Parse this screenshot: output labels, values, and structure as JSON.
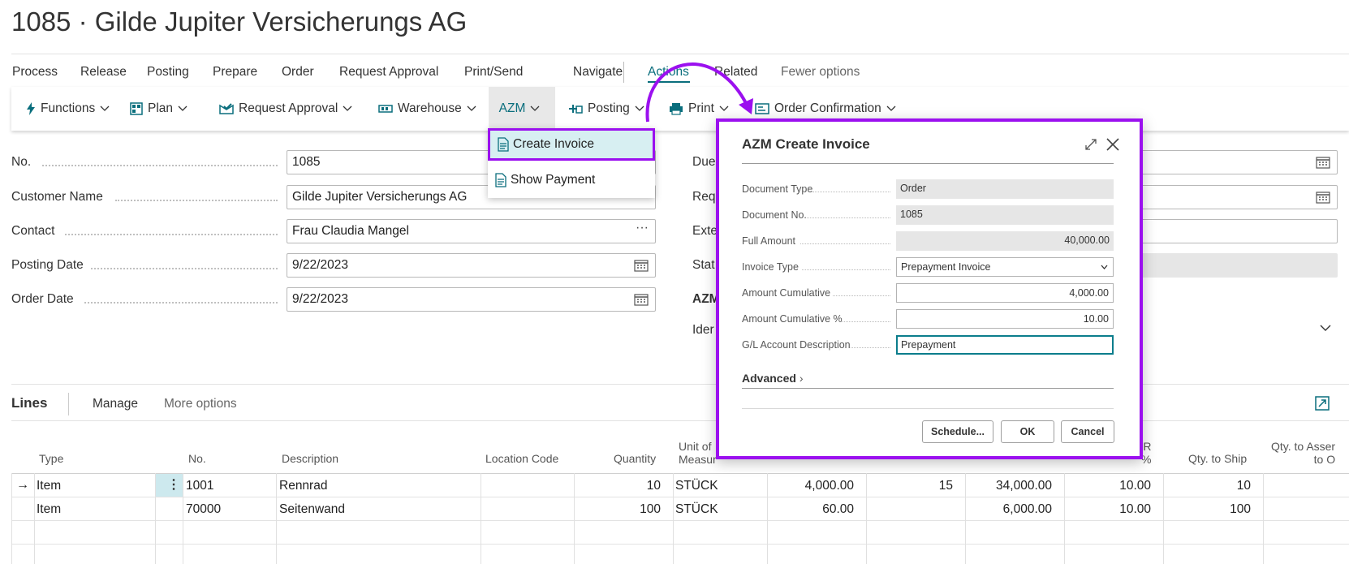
{
  "page_title": "1085 · Gilde Jupiter Versicherungs AG",
  "nav": {
    "items": [
      "Process",
      "Release",
      "Posting",
      "Prepare",
      "Order",
      "Request Approval",
      "Print/Send",
      "Navigate",
      "Actions",
      "Related",
      "Fewer options"
    ],
    "active": "Actions"
  },
  "toolbar": {
    "items": [
      "Functions",
      "Plan",
      "Request Approval",
      "Warehouse",
      "AZM",
      "Posting",
      "Print",
      "Order Confirmation"
    ]
  },
  "azm_menu": {
    "items": [
      "Create Invoice",
      "Show Payment"
    ],
    "highlighted": "Create Invoice"
  },
  "general": {
    "fields": [
      {
        "label": "No.",
        "value": "1085"
      },
      {
        "label": "Customer Name",
        "value": "Gilde Jupiter Versicherungs AG"
      },
      {
        "label": "Contact",
        "value": "Frau Claudia Mangel"
      },
      {
        "label": "Posting Date",
        "value": "9/22/2023"
      },
      {
        "label": "Order Date",
        "value": "9/22/2023"
      }
    ],
    "right_labels": [
      "Due",
      "Req",
      "Exte",
      "Stat",
      "AZM",
      "Ider"
    ]
  },
  "modal": {
    "title": "AZM Create Invoice",
    "fields": [
      {
        "label": "Document Type",
        "value": "Order"
      },
      {
        "label": "Document No.",
        "value": "1085"
      },
      {
        "label": "Full Amount",
        "value": "40,000.00"
      },
      {
        "label": "Invoice Type",
        "value": "Prepayment Invoice"
      },
      {
        "label": "Amount Cumulative",
        "value": "4,000.00"
      },
      {
        "label": "Amount Cumulative %",
        "value": "10.00"
      },
      {
        "label": "G/L Account Description",
        "value": "Prepayment"
      }
    ],
    "advanced_label": "Advanced",
    "buttons": {
      "schedule": "Schedule...",
      "ok": "OK",
      "cancel": "Cancel"
    }
  },
  "lines": {
    "title": "Lines",
    "manage": "Manage",
    "more_options": "More options",
    "headers": {
      "type": "Type",
      "no": "No.",
      "description": "Description",
      "location_code": "Location Code",
      "quantity": "Quantity",
      "unit_l1": "Unit of",
      "unit_l2": "Measur",
      "pct_l1": "R",
      "pct_l2": "%",
      "qty_to_ship": "Qty. to Ship",
      "qty_to_assemble_l1": "Qty. to Asser",
      "qty_to_assemble_l2": "to O"
    },
    "rows": [
      {
        "type": "Item",
        "no": "1001",
        "description": "Rennrad",
        "quantity": "10",
        "unit": "STÜCK",
        "unit_price": "4,000.00",
        "discount": "15",
        "amount": "34,000.00",
        "pct": "10.00",
        "qty_to_ship": "10"
      },
      {
        "type": "Item",
        "no": "70000",
        "description": "Seitenwand",
        "quantity": "100",
        "unit": "STÜCK",
        "unit_price": "60.00",
        "discount": "",
        "amount": "6,000.00",
        "pct": "10.00",
        "qty_to_ship": "100"
      }
    ]
  },
  "colors": {
    "accent": "#0a6e7d",
    "highlight": "#9b10ef",
    "selected_bg": "#d7eff2"
  }
}
